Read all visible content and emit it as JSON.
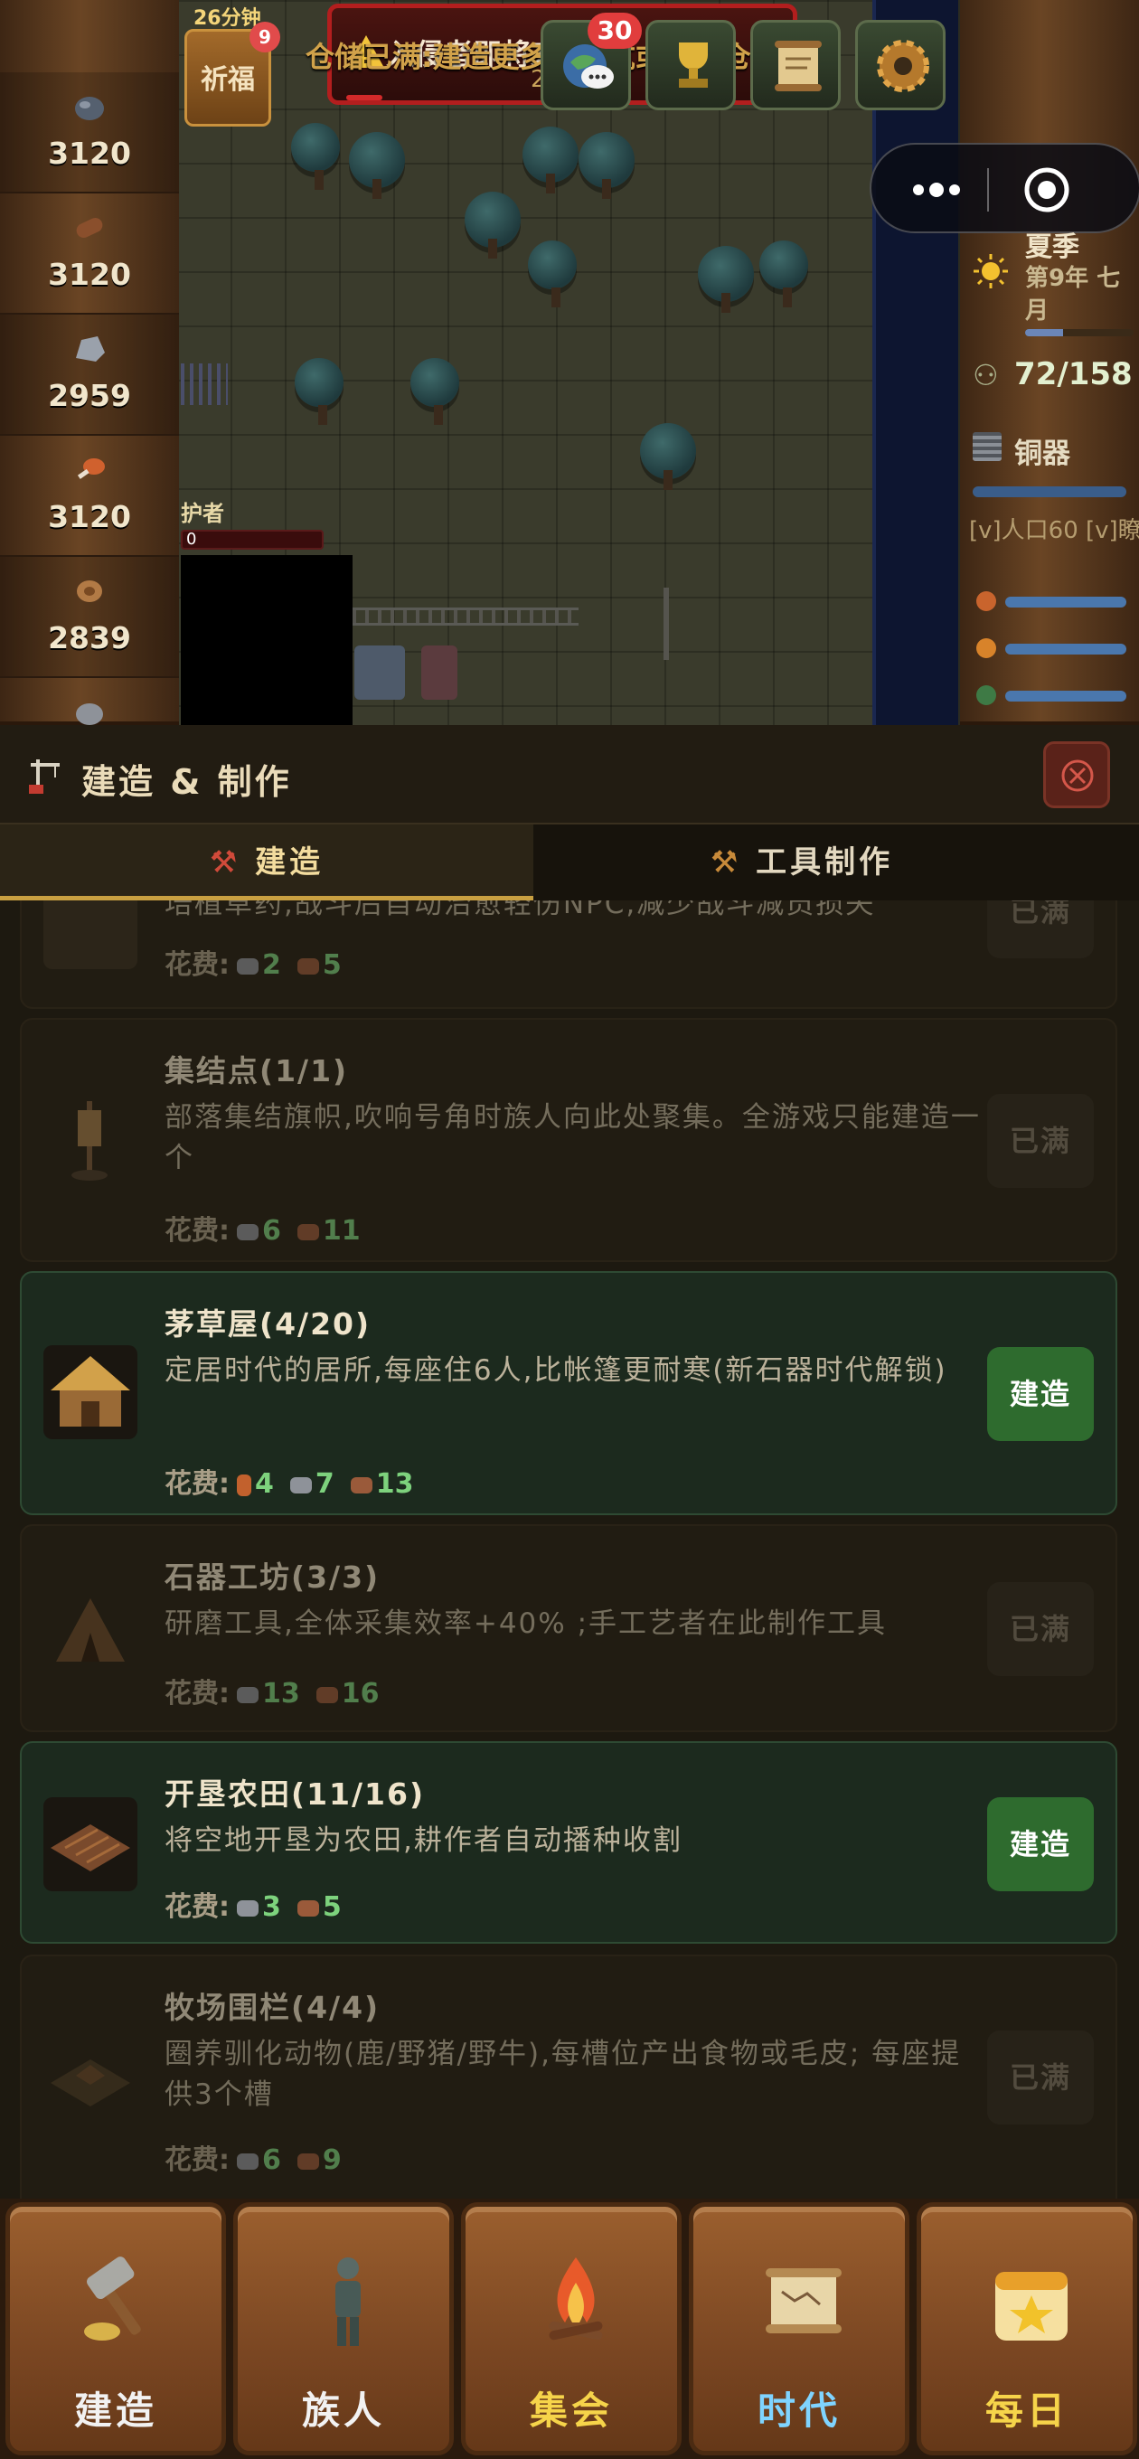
{
  "top": {
    "pray_timer": "26分钟",
    "pray_label": "祈福",
    "pray_badge": "9",
    "banner_title": "入侵者即将来袭",
    "banner_sub": "2",
    "warning": "仓储已满:建造更多储藏坑或大型仓库",
    "chat_badge": "30"
  },
  "resources": [
    "3120",
    "3120",
    "2959",
    "3120",
    "2839"
  ],
  "map": {
    "guard_label": "护者",
    "guard_value": "0"
  },
  "stats": {
    "season": "夏季",
    "year": "第9年 七月",
    "population": "72/158",
    "age": "铜器",
    "news": "[v]人口60 [v]瞭"
  },
  "panel": {
    "title": "建造 & 制作",
    "tabs": [
      "建造",
      "工具制作"
    ]
  },
  "buildings": [
    {
      "name": "",
      "desc": "培植草药,战斗后自动治愈轻伤NPC,减少战斗减员损失",
      "cost_label": "花费:",
      "costs": [
        "2",
        "5"
      ],
      "button": "已满"
    },
    {
      "name": "集结点(1/1)",
      "desc": "部落集结旗帜,吹响号角时族人向此处聚集。全游戏只能建造一个",
      "cost_label": "花费:",
      "costs": [
        "6",
        "11"
      ],
      "button": "已满"
    },
    {
      "name": "茅草屋(4/20)",
      "desc": "定居时代的居所,每座住6人,比帐篷更耐寒(新石器时代解锁)",
      "cost_label": "花费:",
      "costs": [
        "4",
        "7",
        "13"
      ],
      "button": "建造"
    },
    {
      "name": "石器工坊(3/3)",
      "desc": "研磨工具,全体采集效率+40% ;手工艺者在此制作工具",
      "cost_label": "花费:",
      "costs": [
        "13",
        "16"
      ],
      "button": "已满"
    },
    {
      "name": "开垦农田(11/16)",
      "desc": "将空地开垦为农田,耕作者自动播种收割",
      "cost_label": "花费:",
      "costs": [
        "3",
        "5"
      ],
      "button": "建造"
    },
    {
      "name": "牧场围栏(4/4)",
      "desc": "圈养驯化动物(鹿/野猪/野牛),每槽位产出食物或毛皮; 每座提供3个槽",
      "cost_label": "花费:",
      "costs": [
        "6",
        "9"
      ],
      "button": "已满"
    }
  ],
  "nav": [
    "建造",
    "族人",
    "集会",
    "时代",
    "每日"
  ],
  "colors": {
    "nav_label_build": "#f2f2f2",
    "nav_label_people": "#f2f2f2",
    "nav_label_gather": "#f6d44a",
    "nav_label_age": "#7fd4ff",
    "nav_label_daily": "#f6d44a",
    "build_button": "#2e6b2e"
  }
}
